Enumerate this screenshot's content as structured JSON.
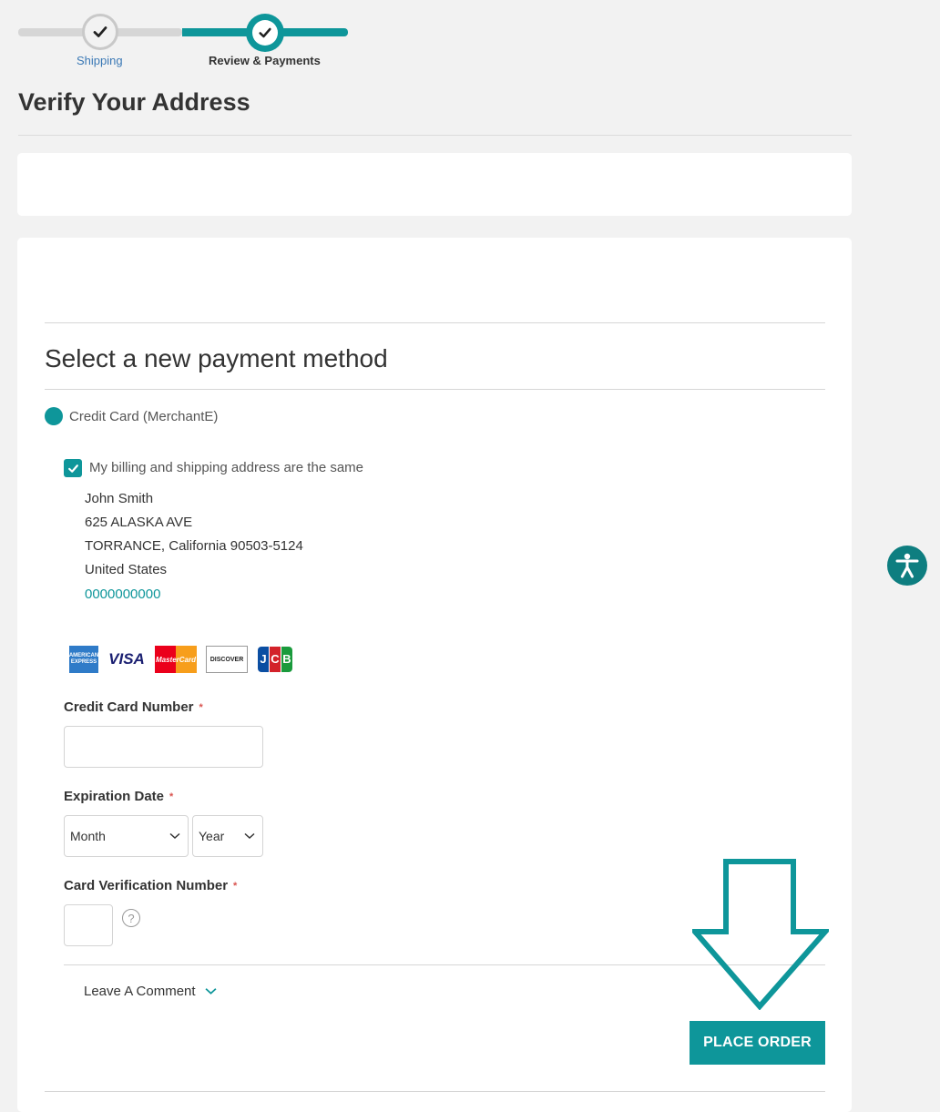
{
  "progress": {
    "steps": [
      {
        "label": "Shipping",
        "state": "complete"
      },
      {
        "label": "Review & Payments",
        "state": "current"
      }
    ]
  },
  "page": {
    "title": "Verify Your Address"
  },
  "payment": {
    "section_title": "Select a new payment method",
    "method_label": "Credit Card (MerchantE)",
    "same_address_label": "My billing and shipping address are the same",
    "same_address_checked": true,
    "address": {
      "name": "John Smith",
      "street": "625 ALASKA AVE",
      "city_line": "TORRANCE, California 90503-5124",
      "country": "United States",
      "phone": "0000000000"
    },
    "card_brands": {
      "amex": "AMERICAN EXPRESS",
      "visa": "VISA",
      "mastercard": "MasterCard",
      "discover": "DISCOVER",
      "jcb": "JCB"
    },
    "fields": {
      "card_number_label": "Credit Card Number",
      "card_number_value": "",
      "expiration_label": "Expiration Date",
      "month_selected": "Month",
      "year_selected": "Year",
      "cvv_label": "Card Verification Number",
      "cvv_value": "",
      "required_marker": "*",
      "help_glyph": "?"
    },
    "comment_label": "Leave A Comment",
    "place_order_label": "PLACE ORDER"
  },
  "colors": {
    "accent": "#0e969a",
    "required": "#d9534f",
    "link": "#3a78b5"
  },
  "icons": {
    "accessibility": "accessibility-icon",
    "check": "check-icon",
    "chevron": "chevron-down-icon",
    "arrow": "arrow-down-outline-icon"
  }
}
